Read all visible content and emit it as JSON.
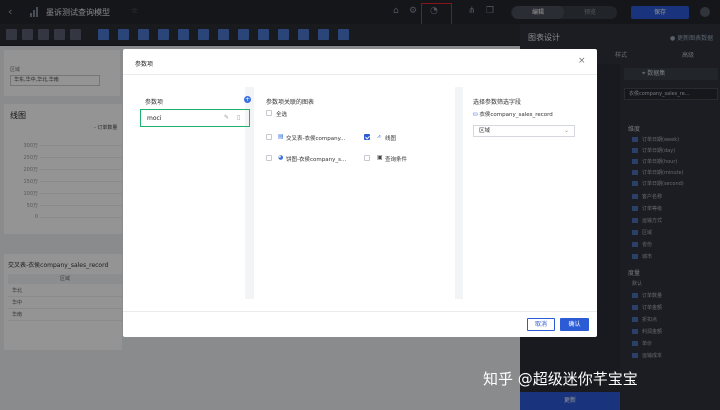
{
  "topbar": {
    "back": "‹",
    "title": "墨诉测试查询模型",
    "star": "☆",
    "mode_edit": "编辑",
    "mode_preview": "预览",
    "save_label": "保存"
  },
  "canvas": {
    "filter_label": "区域",
    "filter_value": "华东,华中,华北,华南",
    "chart_title": "线图",
    "chart_legend": "- 订单数量",
    "chart_yticks": [
      "300万",
      "250万",
      "200万",
      "150万",
      "100万",
      "50万",
      "0"
    ],
    "table_title": "交叉表-衣侯company_sales_record",
    "table_header": "区域",
    "table_rows": [
      "华北",
      "华中",
      "华南"
    ]
  },
  "right_panel": {
    "title": "图表设计",
    "update_toggle": "● 更新图表数据",
    "tab_style": "样式",
    "tab_advanced": "高级",
    "sub_tab": "⌖ 数据集",
    "dataset": "衣侯company_sales_re...",
    "dim_group": "维度",
    "dim_fields": [
      "订单日期(week)",
      "订单日期(day)",
      "订单日期(hour)",
      "订单日期(minute)",
      "订单日期(second)",
      "客户名称",
      "订单等级",
      "运输方式",
      "区域",
      "省份",
      "城市"
    ],
    "measure_group": "度量",
    "measure_subgroup": "默认",
    "measure_fields": [
      "订单数量",
      "订单金额",
      "折扣点",
      "利润金额",
      "单价",
      "运输成本"
    ],
    "update_button": "更新"
  },
  "dialog": {
    "title": "参数项",
    "close": "×",
    "col1_header": "参数项",
    "add": "+",
    "param_name": "moci",
    "col2_header": "参数项关联的图表",
    "select_all": "全选",
    "charts": [
      {
        "name": "交叉表-衣侯company...",
        "checked": false
      },
      {
        "name": "线图",
        "checked": true
      },
      {
        "name": "饼图-衣侯company_s...",
        "checked": false
      },
      {
        "name": "查询条件",
        "checked": false
      }
    ],
    "col3_header": "选择参数筛选字段",
    "dataset_line": "衣侯company_sales_record",
    "field_value": "区域",
    "chevron": "⌄",
    "cancel_label": "取消",
    "ok_label": "确认"
  },
  "watermark": "知乎 @超级迷你芊宝宝",
  "colors": {
    "accent": "#2c5bd6",
    "highlight": "#e3262b",
    "selected_border": "#1fb26a"
  }
}
